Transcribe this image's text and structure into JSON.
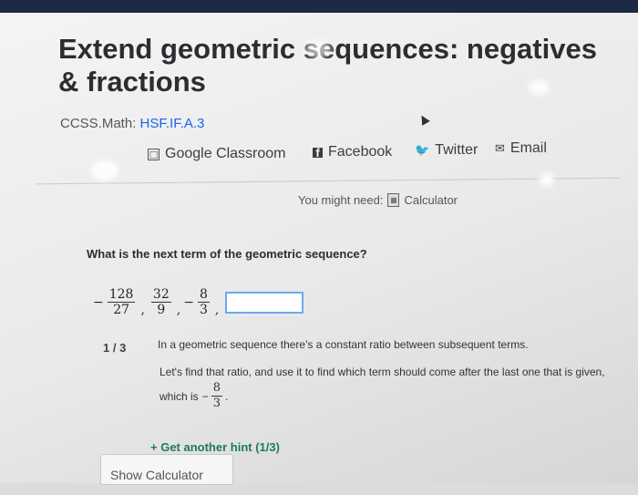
{
  "page": {
    "title": "Extend geometric sequences: negatives & fractions",
    "standard_prefix": "CCSS.Math:",
    "standard_link": "HSF.IF.A.3"
  },
  "share": {
    "google_classroom": "Google Classroom",
    "facebook": "Facebook",
    "twitter": "Twitter",
    "email": "Email"
  },
  "tools": {
    "you_might_need": "You might need:",
    "calculator": "Calculator"
  },
  "exercise": {
    "question": "What is the next term of the geometric sequence?",
    "sequence": [
      {
        "sign": "−",
        "num": "128",
        "den": "27"
      },
      {
        "sign": "",
        "num": "32",
        "den": "9"
      },
      {
        "sign": "−",
        "num": "8",
        "den": "3"
      }
    ],
    "answer_value": ""
  },
  "hint": {
    "counter": "1 / 3",
    "line1": "In a geometric sequence there's a constant ratio between subsequent terms.",
    "line2": "Let's find that ratio, and use it to find which term should come after the last one that is given,",
    "line3_prefix": "which is",
    "line3_sign": "−",
    "line3_num": "8",
    "line3_den": "3",
    "line3_suffix": ".",
    "get_another": "+ Get another hint (1/3)"
  },
  "buttons": {
    "show_calculator": "Show Calculator"
  },
  "colors": {
    "link": "#1865f2",
    "hint_green": "#1c7c54",
    "answer_border": "#6ea8f0"
  }
}
